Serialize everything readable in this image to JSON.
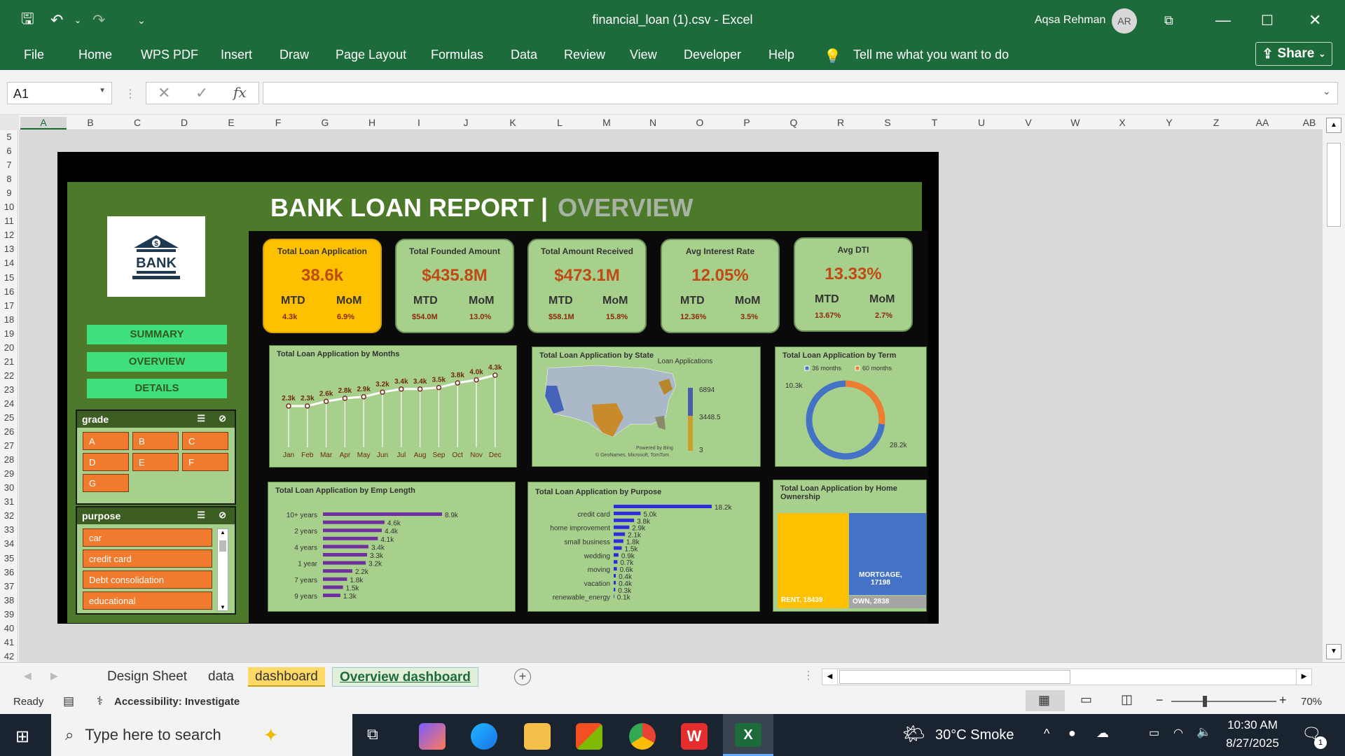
{
  "titlebar": {
    "filename": "financial_loan (1).csv",
    "app": "Excel",
    "user": "Aqsa Rehman",
    "initials": "AR"
  },
  "ribbon": {
    "tabs": [
      "File",
      "Home",
      "WPS PDF",
      "Insert",
      "Draw",
      "Page Layout",
      "Formulas",
      "Data",
      "Review",
      "View",
      "Developer",
      "Help"
    ],
    "tell": "Tell me what you want to do",
    "share": "Share"
  },
  "formula_bar": {
    "cell": "A1",
    "fx": "fx",
    "content": ""
  },
  "columns": [
    "A",
    "B",
    "C",
    "D",
    "E",
    "F",
    "G",
    "H",
    "I",
    "J",
    "K",
    "L",
    "M",
    "N",
    "O",
    "P",
    "Q",
    "R",
    "S",
    "T",
    "U",
    "V",
    "W",
    "X",
    "Y",
    "Z",
    "AA",
    "AB"
  ],
  "rows": [
    "5",
    "6",
    "7",
    "8",
    "9",
    "10",
    "11",
    "12",
    "13",
    "14",
    "15",
    "16",
    "17",
    "18",
    "19",
    "20",
    "21",
    "22",
    "23",
    "24",
    "25",
    "26",
    "27",
    "28",
    "29",
    "30",
    "31",
    "32",
    "33",
    "34",
    "35",
    "36",
    "37",
    "38",
    "39",
    "40",
    "41",
    "42"
  ],
  "dashboard": {
    "title": "BANK LOAN REPORT |",
    "subtitle": "OVERVIEW",
    "logo_text": "BANK",
    "nav": [
      "SUMMARY",
      "OVERVIEW",
      "DETAILS"
    ],
    "grade_slicer": {
      "title": "grade",
      "items": [
        "A",
        "B",
        "C",
        "D",
        "E",
        "F",
        "G"
      ]
    },
    "purpose_slicer": {
      "title": "purpose",
      "items": [
        "car",
        "credit card",
        "Debt consolidation",
        "educational"
      ]
    },
    "kpis": [
      {
        "title": "Total Loan Application",
        "value": "38.6k",
        "mtd_label": "MTD",
        "mom_label": "MoM",
        "mtd": "4.3k",
        "mom": "6.9%"
      },
      {
        "title": "Total Founded Amount",
        "value": "$435.8M",
        "mtd_label": "MTD",
        "mom_label": "MoM",
        "mtd": "$54.0M",
        "mom": "13.0%"
      },
      {
        "title": "Total Amount Received",
        "value": "$473.1M",
        "mtd_label": "MTD",
        "mom_label": "MoM",
        "mtd": "$58.1M",
        "mom": "15.8%"
      },
      {
        "title": "Avg Interest Rate",
        "value": "12.05%",
        "mtd_label": "MTD",
        "mom_label": "MoM",
        "mtd": "12.36%",
        "mom": "3.5%"
      },
      {
        "title": "Avg DTI",
        "value": "13.33%",
        "mtd_label": "MTD",
        "mom_label": "MoM",
        "mtd": "13.67%",
        "mom": "2.7%"
      }
    ],
    "map": {
      "title": "Total Loan Application by State",
      "legend_title": "Loan Applications",
      "max": "6894",
      "mid": "3448.5",
      "min": "3",
      "credit1": "Powered by Bing",
      "credit2": "© GeoNames, Microsoft, TomTom"
    },
    "treemap": {
      "title": "Total Loan Application by Home Ownership",
      "rent": "RENT, 18439",
      "mortgage": "MORTGAGE, 17198",
      "own": "OWN, 2838"
    }
  },
  "chart_data": [
    {
      "type": "line",
      "title": "Total Loan Application by Months",
      "categories": [
        "Jan",
        "Feb",
        "Mar",
        "Apr",
        "May",
        "Jun",
        "Jul",
        "Aug",
        "Sep",
        "Oct",
        "Nov",
        "Dec"
      ],
      "values": [
        2.3,
        2.3,
        2.6,
        2.8,
        2.9,
        3.2,
        3.4,
        3.4,
        3.5,
        3.8,
        4.0,
        4.3
      ],
      "labels": [
        "2.3k",
        "2.3k",
        "2.6k",
        "2.8k",
        "2.9k",
        "3.2k",
        "3.4k",
        "3.4k",
        "3.5k",
        "3.8k",
        "4.0k",
        "4.3k"
      ]
    },
    {
      "type": "pie",
      "title": "Total Loan Application by Term",
      "categories": [
        "36 months",
        "60 months"
      ],
      "values": [
        28.2,
        10.3
      ],
      "labels": [
        "28.2k",
        "10.3k"
      ],
      "colors": [
        "#4472c4",
        "#ed7d31"
      ]
    },
    {
      "type": "bar",
      "title": "Total Loan Application by Emp Length",
      "categories": [
        "10+ years",
        "",
        "2 years",
        "",
        "4 years",
        "",
        "1 year",
        "",
        "7 years",
        "",
        "9 years"
      ],
      "values": [
        8.9,
        4.6,
        4.4,
        4.1,
        3.4,
        3.3,
        3.2,
        2.2,
        1.8,
        1.5,
        1.3
      ],
      "labels": [
        "8.9k",
        "4.6k",
        "4.4k",
        "4.1k",
        "3.4k",
        "3.3k",
        "3.2k",
        "2.2k",
        "1.8k",
        "1.5k",
        "1.3k"
      ]
    },
    {
      "type": "bar",
      "title": "Total Loan Application by Purpose",
      "categories": [
        "",
        "credit card",
        "",
        "home improvement",
        "",
        "small business",
        "",
        "wedding",
        "",
        "moving",
        "",
        "vacation",
        "",
        "renewable_energy"
      ],
      "values": [
        18.2,
        5.0,
        3.8,
        2.9,
        2.1,
        1.8,
        1.5,
        0.9,
        0.7,
        0.6,
        0.4,
        0.4,
        0.3,
        0.1
      ],
      "labels": [
        "18.2k",
        "5.0k",
        "3.8k",
        "2.9k",
        "2.1k",
        "1.8k",
        "1.5k",
        "0.9k",
        "0.7k",
        "0.6k",
        "0.4k",
        "0.4k",
        "0.3k",
        "0.1k"
      ]
    }
  ],
  "sheet_tabs": [
    "Design Sheet",
    "data",
    "dashboard",
    "Overview dashboard"
  ],
  "status": {
    "ready": "Ready",
    "accessibility": "Accessibility: Investigate",
    "zoom": "70%"
  },
  "taskbar": {
    "search_placeholder": "Type here to search",
    "weather": "30°C  Smoke",
    "time": "10:30 AM",
    "date": "8/27/2025",
    "notif": "1"
  }
}
